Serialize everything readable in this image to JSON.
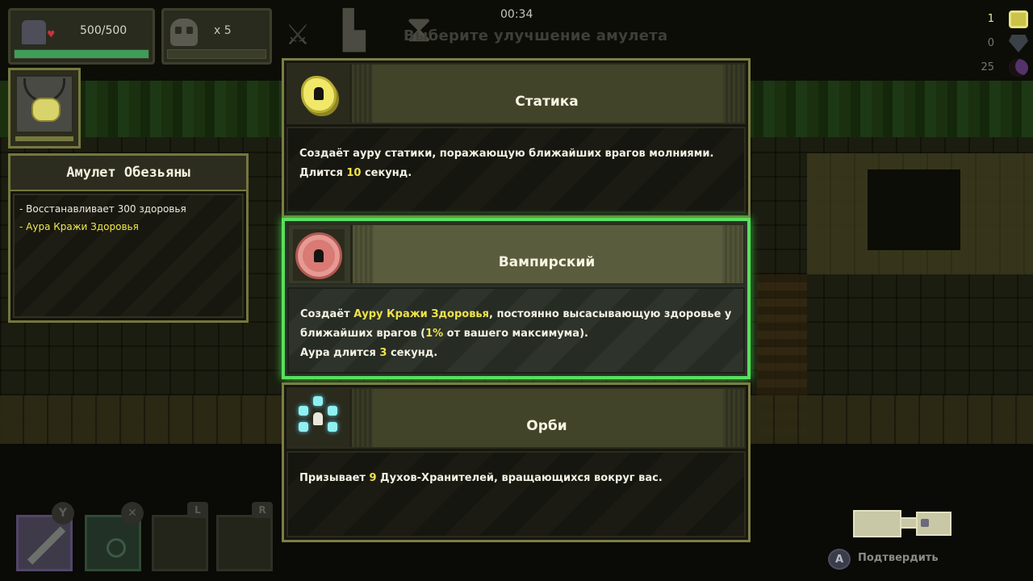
{
  "hud": {
    "health": "500/500",
    "health_fill": 1.0,
    "kills": "x 5",
    "timer": "00:34",
    "prompt": "Выберите улучшение амулета",
    "resources": [
      {
        "name": "gold",
        "value": "1",
        "icon": "gold-coin-icon"
      },
      {
        "name": "gems",
        "value": "0",
        "icon": "gem-icon"
      },
      {
        "name": "souls",
        "value": "25",
        "icon": "moon-icon"
      }
    ]
  },
  "amulet": {
    "title": "Амулет Обезьяны",
    "effects": [
      {
        "text": "- Восстанавливает 300 здоровья",
        "color": "white"
      },
      {
        "text": "- Аура Кражи Здоровья",
        "color": "yellow"
      }
    ]
  },
  "cards": [
    {
      "title": "Статика",
      "icon": "static-icon",
      "desc": [
        {
          "t": "Создаёт ауру статики, поражающую ближайших врагов молниями. Длится ",
          "hl": false
        },
        {
          "t": "10",
          "hl": true
        },
        {
          "t": " секунд.",
          "hl": false
        }
      ]
    },
    {
      "title": "Вампирский",
      "icon": "vampire-icon",
      "selected": true,
      "desc": [
        {
          "t": "Создаёт ",
          "hl": false
        },
        {
          "t": "Ауру Кражи Здоровья",
          "hl": true
        },
        {
          "t": ", постоянно высасывающую здоровье у ближайших врагов (",
          "hl": false
        },
        {
          "t": "1%",
          "hl": true
        },
        {
          "t": " от вашего максимума).",
          "hl": false
        },
        {
          "t": "Аура длится ",
          "hl": false
        },
        {
          "t": "3",
          "hl": true
        },
        {
          "t": " секунд.",
          "hl": false
        }
      ]
    },
    {
      "title": "Орби",
      "icon": "orbs-icon",
      "desc": [
        {
          "t": "Призывает ",
          "hl": false
        },
        {
          "t": "9",
          "hl": true
        },
        {
          "t": " Духов-Хранителей, вращающихся вокруг вас.",
          "hl": false
        }
      ]
    }
  ],
  "controls": {
    "y": "Y",
    "x": "✕",
    "l": "L",
    "r": "R",
    "confirm_button": "A",
    "confirm_label": "Подтвердить"
  },
  "colors": {
    "highlight": "#eee24a",
    "selected_border": "#58e05c",
    "panel_border": "#7c7e45"
  }
}
